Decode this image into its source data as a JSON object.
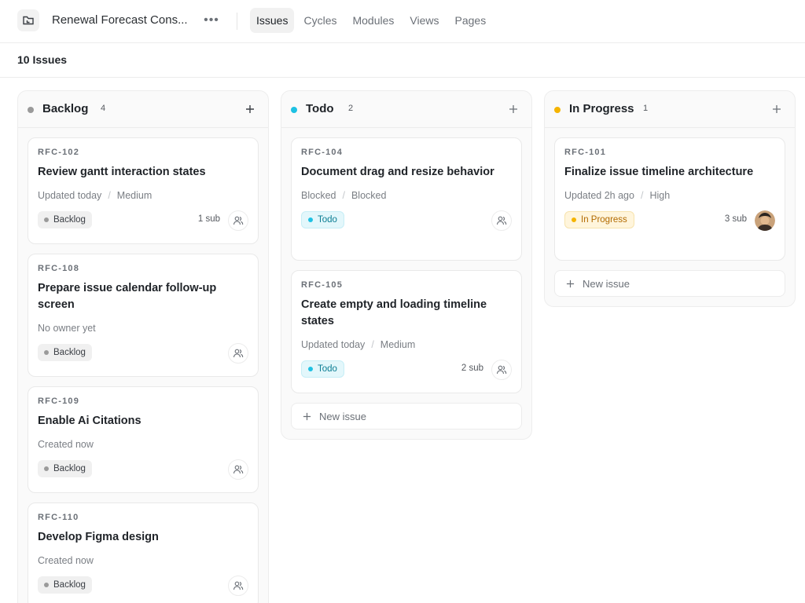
{
  "header": {
    "project_title": "Renewal Forecast Cons...",
    "project_icon": "folder-icon",
    "more_icon": "ellipsis-icon",
    "tabs": [
      {
        "label": "Issues",
        "active": true
      },
      {
        "label": "Cycles",
        "active": false
      },
      {
        "label": "Modules",
        "active": false
      },
      {
        "label": "Views",
        "active": false
      },
      {
        "label": "Pages",
        "active": false
      }
    ]
  },
  "subheader": {
    "issue_count": "10 Issues"
  },
  "colors": {
    "backlog": "#9a9a9a",
    "todo": "#1ec1e3",
    "in_progress": "#f5b400"
  },
  "columns": [
    {
      "title": "Backlog",
      "count": "4",
      "cards": [
        {
          "id": "RFC-102",
          "title": "Review gantt interaction states",
          "meta": [
            "Updated today",
            "Medium"
          ],
          "status": "Backlog",
          "sub": "1 sub"
        },
        {
          "id": "RFC-108",
          "title": "Prepare issue calendar follow-up screen",
          "meta": [
            "No owner yet"
          ],
          "status": "Backlog",
          "sub": ""
        },
        {
          "id": "RFC-109",
          "title": "Enable Ai Citations",
          "meta": [
            "Created now"
          ],
          "status": "Backlog",
          "sub": ""
        },
        {
          "id": "RFC-110",
          "title": "Develop Figma design",
          "meta": [
            "Created now"
          ],
          "status": "Backlog",
          "sub": ""
        }
      ]
    },
    {
      "title": "Todo",
      "count": "2",
      "cards": [
        {
          "id": "RFC-104",
          "title": "Document drag and resize behavior",
          "meta": [
            "Blocked",
            "Blocked"
          ],
          "status": "Todo",
          "sub": ""
        },
        {
          "id": "RFC-105",
          "title": "Create empty and loading timeline states",
          "meta": [
            "Updated today",
            "Medium"
          ],
          "status": "Todo",
          "sub": "2 sub"
        }
      ],
      "new_issue_label": "New issue"
    },
    {
      "title": "In Progress",
      "count": "1",
      "cards": [
        {
          "id": "RFC-101",
          "title": "Finalize issue timeline architecture",
          "meta": [
            "Updated 2h ago",
            "High"
          ],
          "status": "In Progress",
          "sub": "3 sub"
        }
      ],
      "new_issue_label": "New issue"
    }
  ]
}
